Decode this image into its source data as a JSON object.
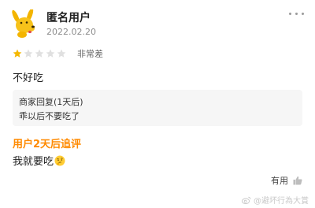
{
  "review": {
    "user": {
      "name": "匿名用户",
      "date": "2022.02.20",
      "avatar": "yellow-dog-avatar"
    },
    "rating": {
      "stars": 1,
      "max": 5,
      "label": "非常差"
    },
    "text": "不好吃",
    "merchant_reply": {
      "title": "商家回复(1天后)",
      "text": "乖以后不要吃了"
    },
    "followup": {
      "label": "用户2天后追评",
      "text": "我就要吃",
      "emoji": "thinking-face"
    },
    "helpful_label": "有用"
  },
  "watermark": {
    "text": "@避坏行為大賞"
  },
  "colors": {
    "accent_orange": "#ff8a00",
    "star_on": "#f5b800",
    "star_off": "#e0e0e0"
  }
}
